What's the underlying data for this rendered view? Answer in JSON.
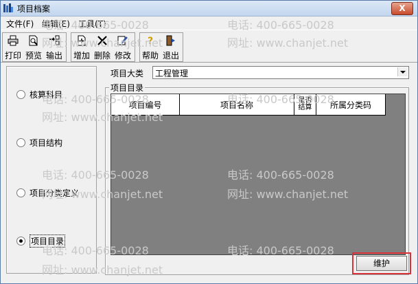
{
  "window": {
    "title": "项目档案",
    "close_label": "X"
  },
  "menu": [
    "文件(F)",
    "编辑(E)",
    "工具(T)"
  ],
  "toolbar": {
    "group1": [
      {
        "label": "打印",
        "icon": "printer-icon"
      },
      {
        "label": "预览",
        "icon": "preview-icon"
      },
      {
        "label": "输出",
        "icon": "export-icon"
      }
    ],
    "group2": [
      {
        "label": "增加",
        "icon": "add-icon"
      },
      {
        "label": "删除",
        "icon": "delete-icon"
      },
      {
        "label": "修改",
        "icon": "edit-icon"
      }
    ],
    "group3": [
      {
        "label": "帮助",
        "icon": "help-icon"
      },
      {
        "label": "退出",
        "icon": "exit-icon"
      }
    ]
  },
  "left_panel": {
    "options": [
      {
        "label": "核算科目",
        "checked": false
      },
      {
        "label": "项目结构",
        "checked": false
      },
      {
        "label": "项目分类定义",
        "checked": false
      },
      {
        "label": "项目目录",
        "checked": true
      }
    ]
  },
  "category": {
    "label": "项目大类",
    "value": "工程管理"
  },
  "directory": {
    "title": "项目目录",
    "columns": [
      "项目编号",
      "项目名称",
      "是否结算",
      "所属分类码"
    ],
    "rows": []
  },
  "maintain_button": "维护",
  "watermark": {
    "phone": "电话: 400-665-0028",
    "site": "网址: www.chanjet.net"
  },
  "colors": {
    "highlight": "#d9313a",
    "grid_bg": "#808080"
  }
}
